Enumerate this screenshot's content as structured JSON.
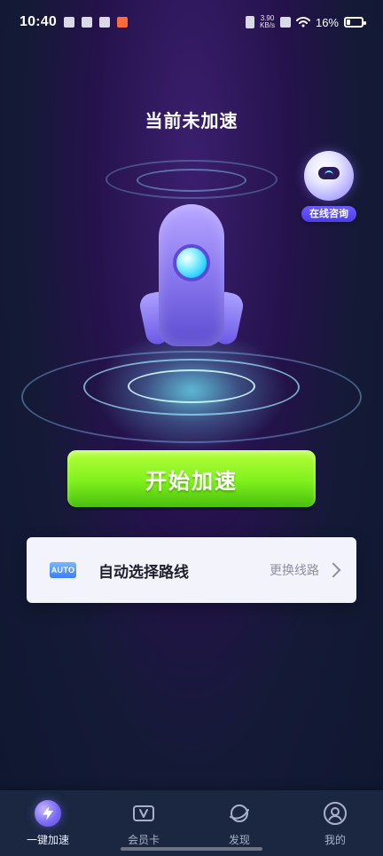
{
  "status_bar": {
    "time": "10:40",
    "netspeed_value": "3.90",
    "netspeed_unit": "KB/s",
    "battery": "16%"
  },
  "main": {
    "status_title": "当前未加速",
    "support_label": "在线咨询",
    "start_button_label": "开始加速"
  },
  "route": {
    "badge": "AUTO",
    "name": "自动选择路线",
    "action_label": "更换线路"
  },
  "bottom_nav": {
    "items": [
      {
        "label": "一键加速",
        "icon": "lightning-icon",
        "active": true
      },
      {
        "label": "会员卡",
        "icon": "vip-card-icon",
        "active": false
      },
      {
        "label": "发现",
        "icon": "planet-icon",
        "active": false
      },
      {
        "label": "我的",
        "icon": "user-icon",
        "active": false
      }
    ]
  },
  "colors": {
    "primary_button": "#7ff01c",
    "nav_background": "#1b2741",
    "accent_purple": "#7b6cf5"
  }
}
